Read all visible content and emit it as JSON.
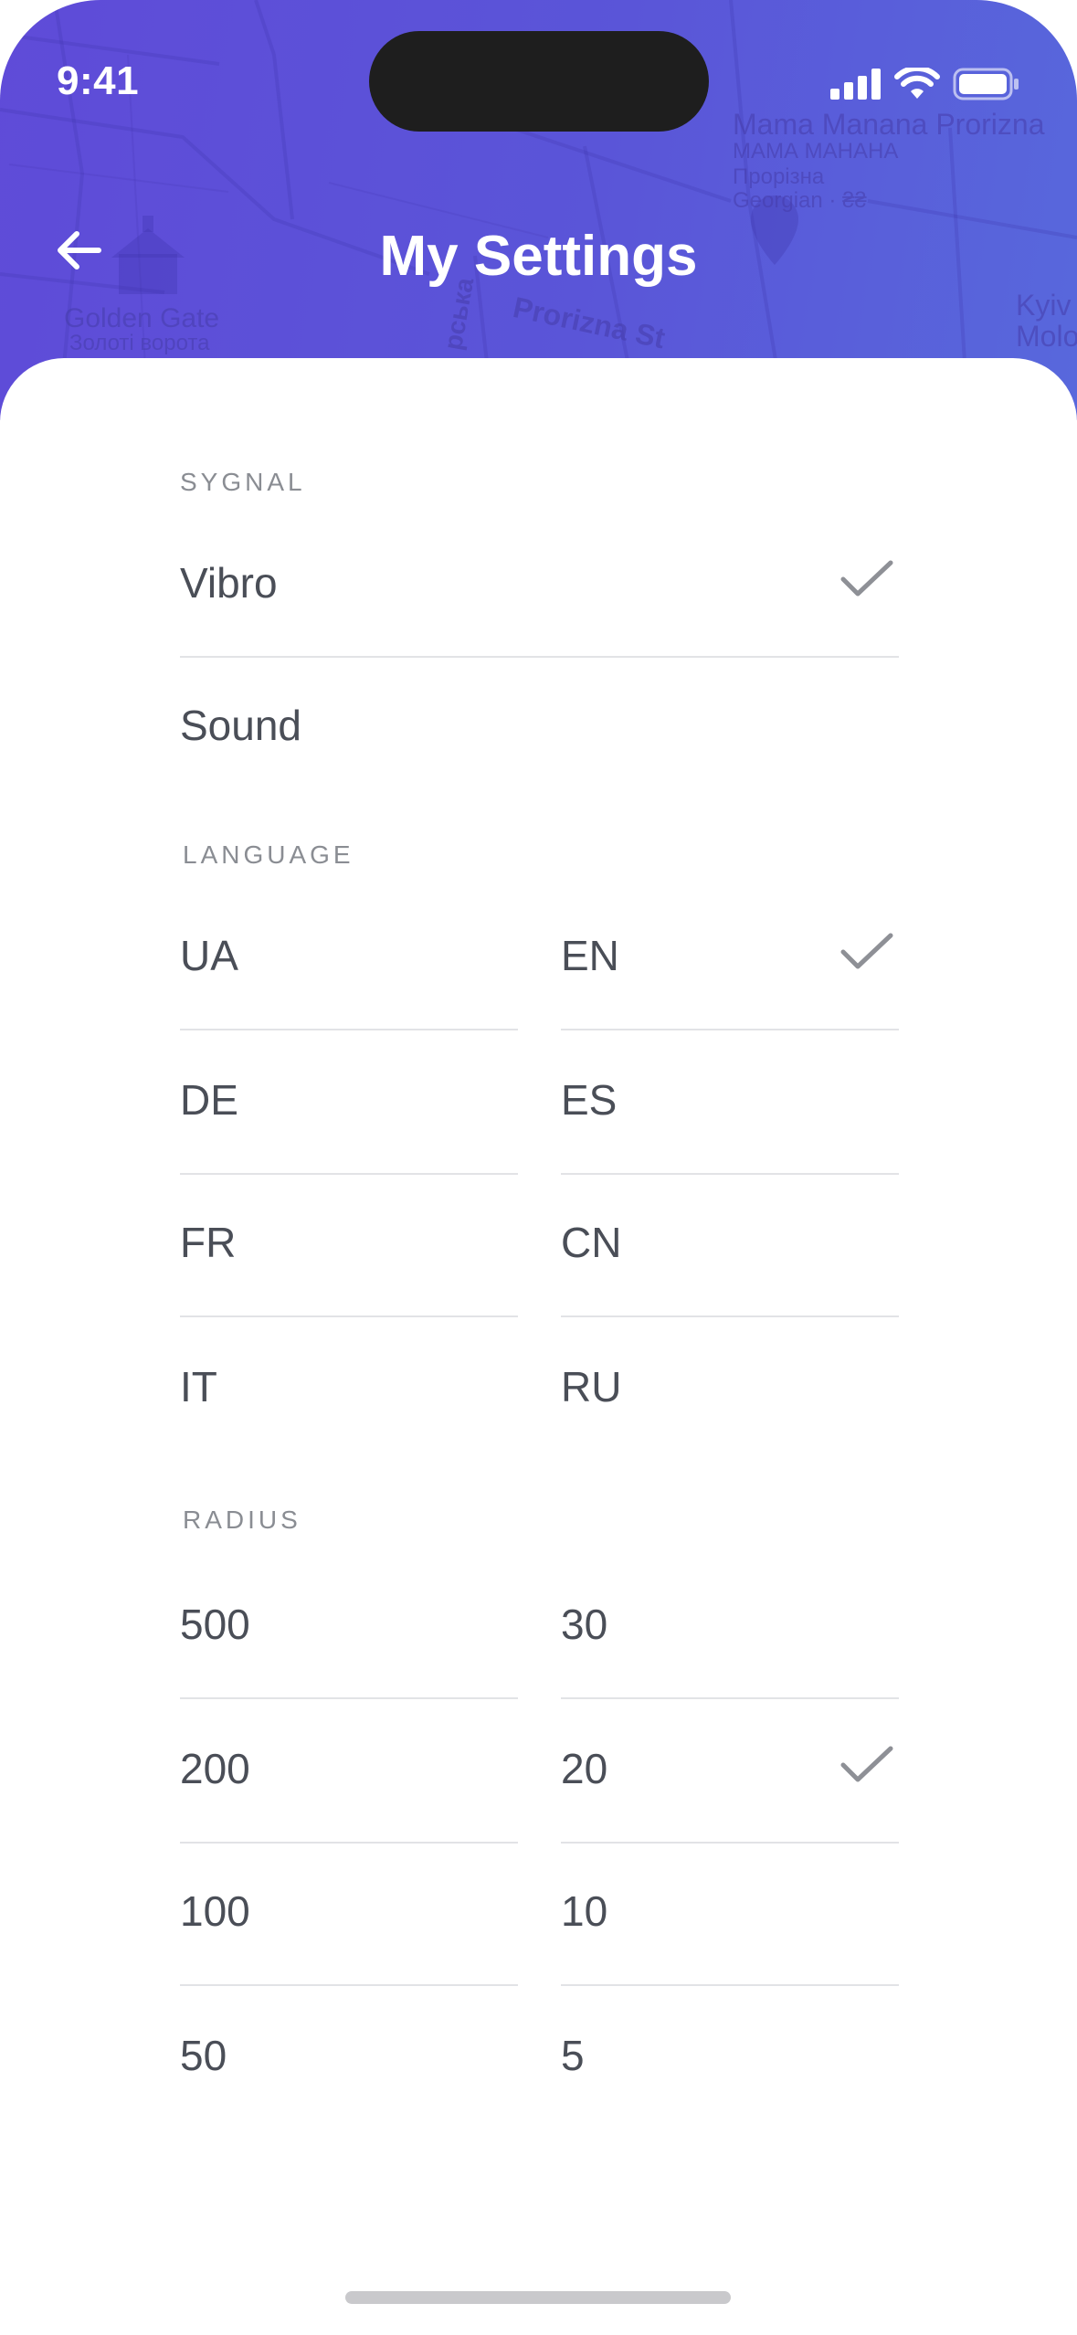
{
  "status_bar": {
    "time": "9:41"
  },
  "header": {
    "title": "My Settings",
    "map_labels": {
      "place_1": "Mama Manana Prorizna",
      "place_1_alt": "МАМА МАНАНА",
      "place_1_sub": "Прорізна",
      "place_1_cat": "Georgian · ₴₴",
      "golden_gate": "Golden Gate",
      "golden_gate_ua": "Золоті ворота",
      "street": "Prorizna St",
      "street_2": "рська",
      "kyiv": "Kyiv",
      "kyiv_2": "Molo"
    }
  },
  "sections": {
    "signal": {
      "label": "SYGNAL",
      "items": [
        {
          "label": "Vibro",
          "checked": true
        },
        {
          "label": "Sound",
          "checked": false
        }
      ]
    },
    "language": {
      "label": "LANGUAGE",
      "left": [
        "UA",
        "DE",
        "FR",
        "IT"
      ],
      "right": [
        "EN",
        "ES",
        "CN",
        "RU"
      ],
      "selected": "EN"
    },
    "radius": {
      "label": "RADIUS",
      "left": [
        "500",
        "200",
        "100",
        "50"
      ],
      "right": [
        "30",
        "20",
        "10",
        "5"
      ],
      "selected": "20"
    }
  },
  "colors": {
    "header_start": "#5f4bd8",
    "header_end": "#5868dc",
    "text": "#4a4e57",
    "section_label": "#8a8d93",
    "check": "#8e9096",
    "divider": "#e2e3e6"
  }
}
